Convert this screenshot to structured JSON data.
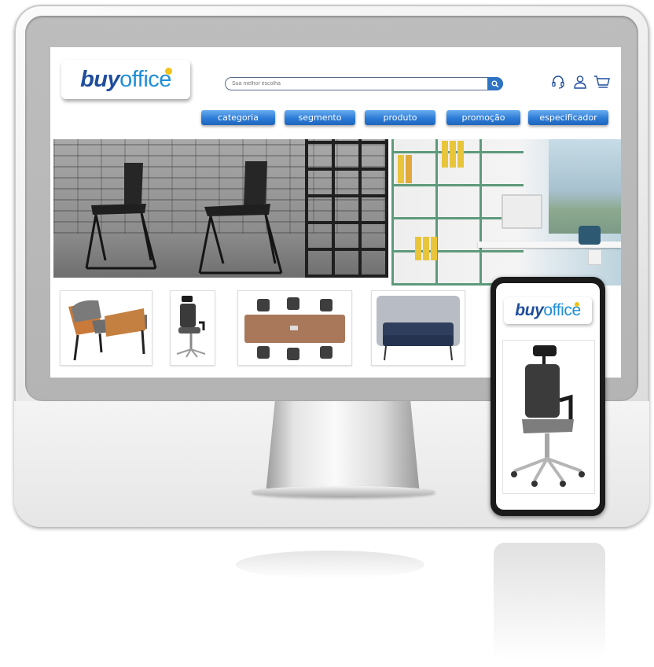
{
  "brand": {
    "part1": "buy",
    "part2": "office"
  },
  "search": {
    "placeholder": "Sua melhor escolha"
  },
  "nav": {
    "items": [
      {
        "label": "categoria"
      },
      {
        "label": "segmento"
      },
      {
        "label": "produto"
      },
      {
        "label": "promoção"
      },
      {
        "label": "especificador"
      }
    ]
  },
  "header_icons": [
    "headset-icon",
    "user-icon",
    "cart-icon"
  ],
  "products": [
    "lounge-armchair",
    "office-chair",
    "meeting-table",
    "sofa-booth"
  ],
  "phone": {
    "brand": {
      "part1": "buy",
      "part2": "office"
    },
    "product": "office-chair"
  },
  "colors": {
    "brand_dark": "#1f4d9e",
    "brand_light": "#1f8fd6",
    "accent_dot": "#f2c318",
    "nav_blue": "#2c7bd6"
  }
}
